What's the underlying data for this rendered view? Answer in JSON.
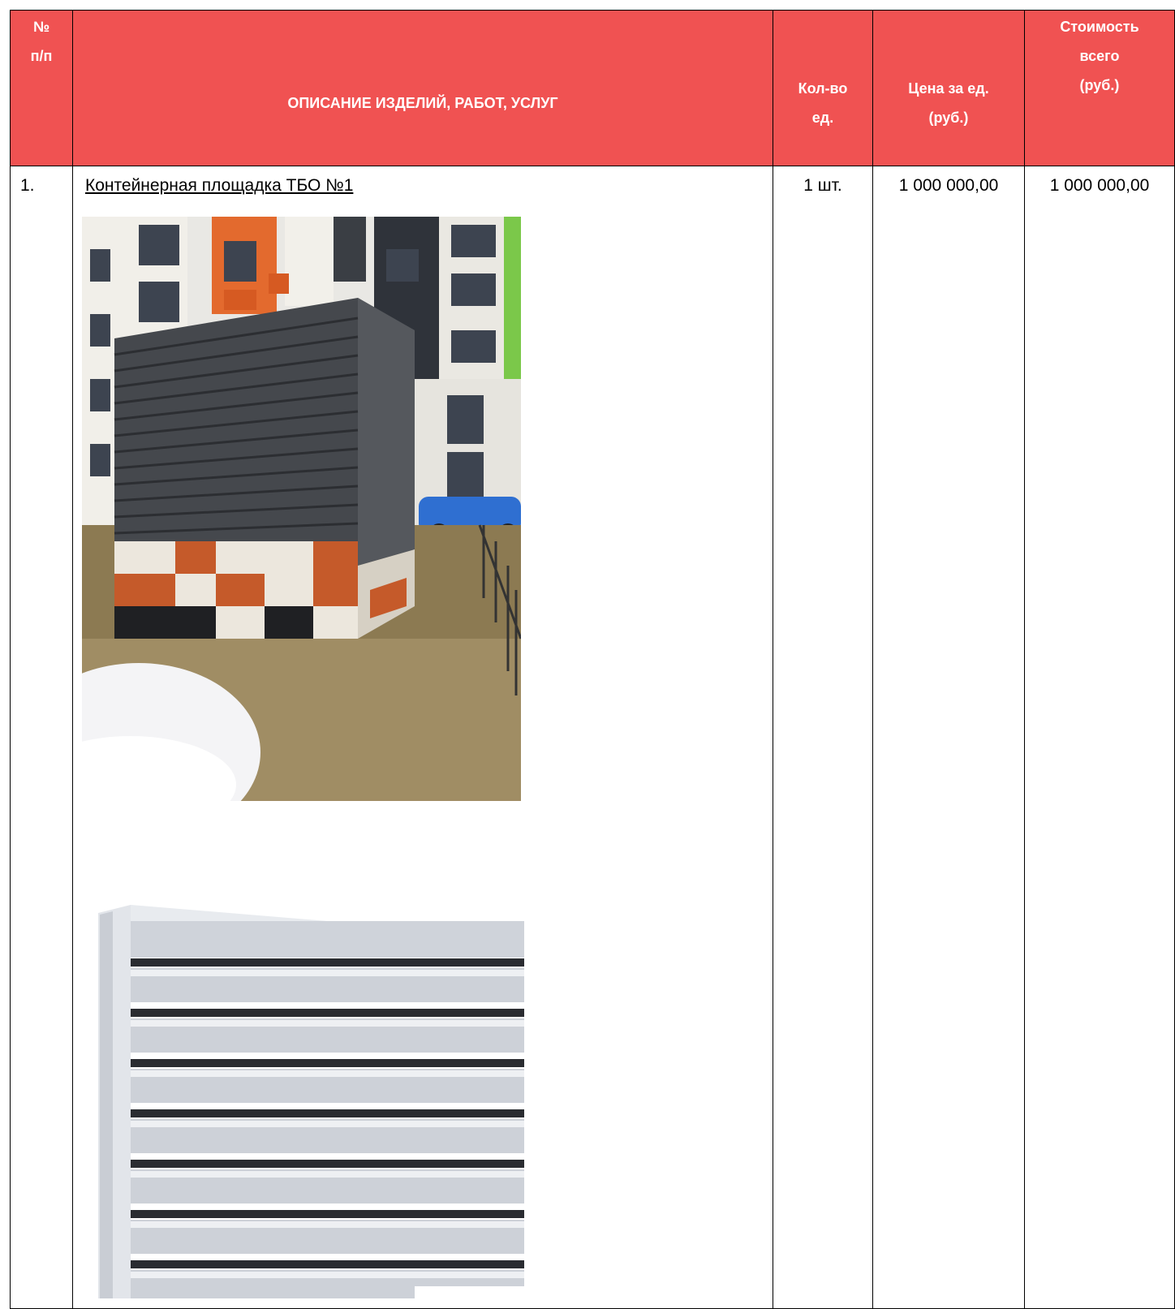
{
  "table": {
    "headers": {
      "num": [
        "№",
        "п/п"
      ],
      "description": "ОПИСАНИЕ ИЗДЕЛИЙ, РАБОТ, УСЛУГ",
      "qty": [
        "Кол-во",
        "ед."
      ],
      "price": [
        "Цена за ед.",
        "(руб.)"
      ],
      "total": [
        "Стоимость",
        "всего",
        "(руб.)"
      ]
    },
    "rows": [
      {
        "num": "1.",
        "description": "Контейнерная площадка ТБО №1",
        "qty": "1 шт.",
        "price": "1 000 000,00",
        "total": "1 000 000,00"
      }
    ]
  },
  "colors": {
    "header_bg": "#f05252",
    "header_text": "#ffffff"
  }
}
